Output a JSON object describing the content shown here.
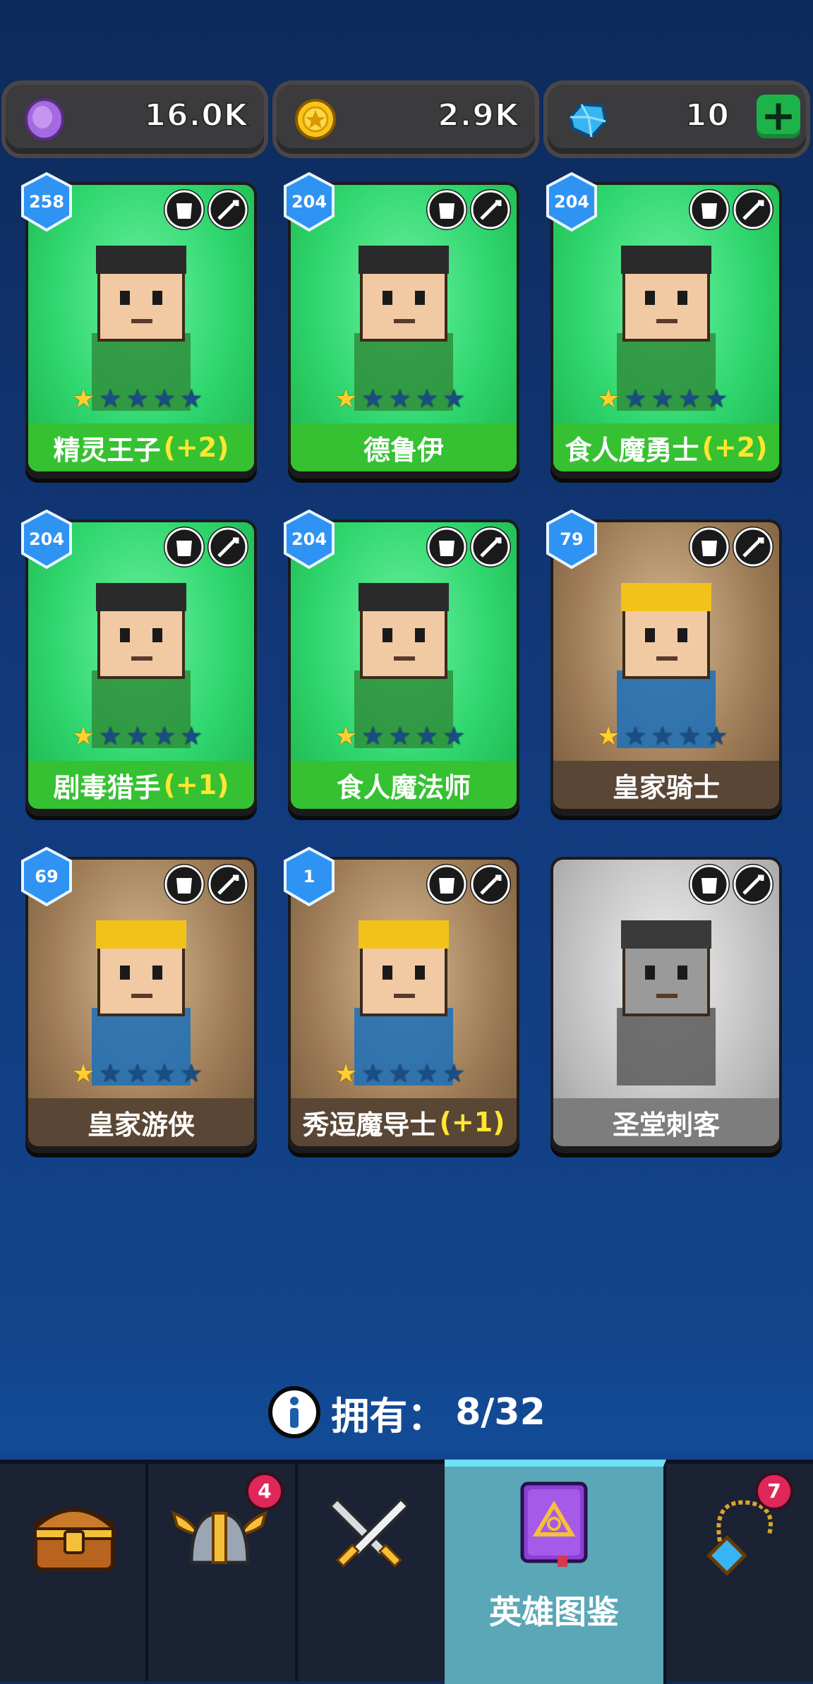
{
  "currencies": [
    {
      "name": "purple-coin",
      "value": "16.0K",
      "color": "#9b57d2"
    },
    {
      "name": "gold-coin",
      "value": "2.9K",
      "color": "#ffcf2d"
    },
    {
      "name": "gem",
      "value": "10",
      "color": "#3bb6f5"
    }
  ],
  "cards": [
    {
      "name": "精灵王子",
      "bonus": "(+2)",
      "level": "258",
      "stars": 1,
      "theme": "green"
    },
    {
      "name": "德鲁伊",
      "bonus": "",
      "level": "204",
      "stars": 1,
      "theme": "green"
    },
    {
      "name": "食人魔勇士",
      "bonus": "(+2)",
      "level": "204",
      "stars": 1,
      "theme": "green"
    },
    {
      "name": "剧毒猎手",
      "bonus": "(+1)",
      "level": "204",
      "stars": 1,
      "theme": "green"
    },
    {
      "name": "食人魔法师",
      "bonus": "",
      "level": "204",
      "stars": 1,
      "theme": "green"
    },
    {
      "name": "皇家骑士",
      "bonus": "",
      "level": "79",
      "stars": 1,
      "theme": "brown"
    },
    {
      "name": "皇家游侠",
      "bonus": "",
      "level": "69",
      "stars": 1,
      "theme": "brown"
    },
    {
      "name": "秀逗魔导士",
      "bonus": "(+1)",
      "level": "1",
      "stars": 1,
      "theme": "brown"
    },
    {
      "name": "圣堂刺客",
      "bonus": "",
      "level": "",
      "stars": 0,
      "theme": "gray"
    }
  ],
  "owned": {
    "label": "拥有：",
    "count": "8/32"
  },
  "nav": {
    "items": [
      {
        "name": "chest",
        "label": "",
        "badge": ""
      },
      {
        "name": "heroes-helmet",
        "label": "",
        "badge": "4"
      },
      {
        "name": "battle",
        "label": "",
        "badge": ""
      },
      {
        "name": "hero-codex",
        "label": "英雄图鉴",
        "badge": ""
      },
      {
        "name": "amulet",
        "label": "",
        "badge": "7"
      }
    ]
  }
}
